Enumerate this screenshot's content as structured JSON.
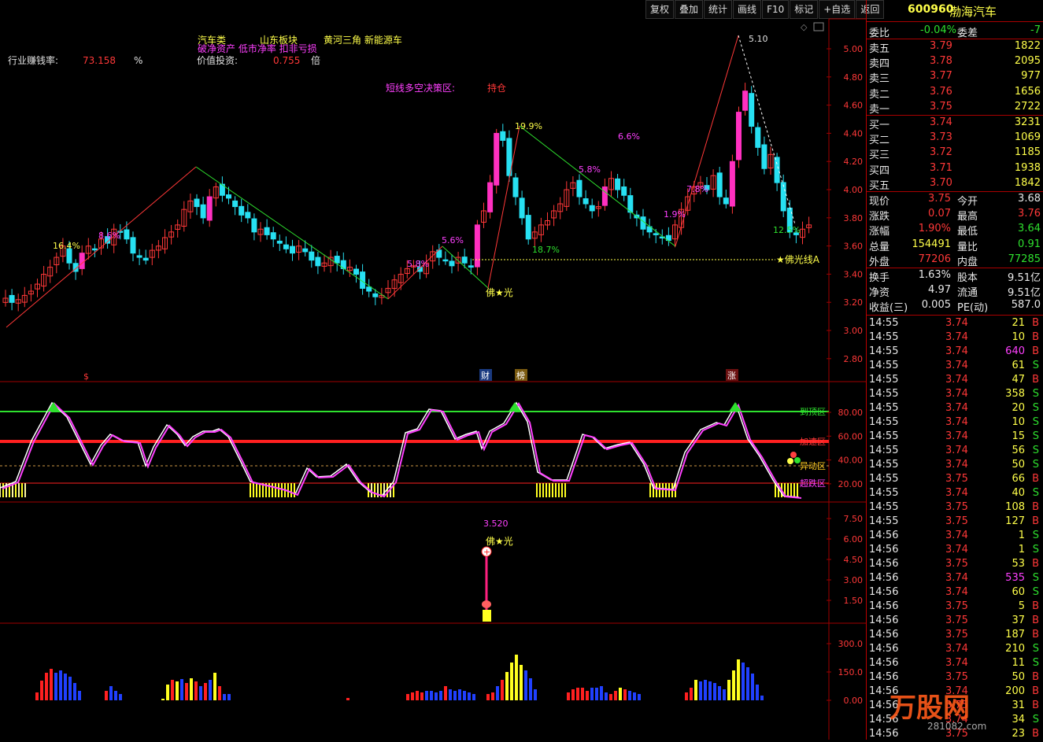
{
  "toolbar": [
    "复权",
    "叠加",
    "统计",
    "画线",
    "F10",
    "标记",
    "+自选",
    "返回"
  ],
  "stock": {
    "code": "600960",
    "name": "渤海汽车"
  },
  "info": {
    "industry_label": "行业赚钱率:",
    "industry_value": "73.158",
    "industry_unit": "%",
    "value_label": "价值投资:",
    "value_value": "0.755",
    "value_unit": "倍",
    "tag1": "汽车类",
    "tag2": "山东板块",
    "tag3": "黄河三角 新能源车",
    "tag4": "破净资产 低市净率 扣非亏损",
    "decision_label": "短线多空决策区:",
    "decision_value": "持仓"
  },
  "main_chart": {
    "y_ticks": [
      "5.00",
      "4.80",
      "4.60",
      "4.40",
      "4.20",
      "4.00",
      "3.80",
      "3.60",
      "3.40",
      "3.20",
      "3.00",
      "2.80"
    ],
    "annotations": [
      "5.10",
      "19.9%",
      "6.6%",
      "5.8%",
      "16.4%",
      "8.6%",
      "5.6%",
      "5.8%",
      "18.7%",
      "1.9%",
      "7.8%",
      "12.5%"
    ],
    "buddha": "佛★光",
    "buddha_line": "★佛光线A",
    "markers": [
      "$",
      "财",
      "榜",
      "涨"
    ]
  },
  "oscillator": {
    "y_ticks": [
      "80.00",
      "60.00",
      "40.00",
      "20.00"
    ],
    "zones": [
      "到顶区",
      "加速区",
      "异动区",
      "超跌区"
    ]
  },
  "signal_panel": {
    "y_ticks": [
      "7.50",
      "6.00",
      "4.50",
      "3.00",
      "1.50"
    ],
    "value": "3.520",
    "label": "佛★光"
  },
  "volume_panel": {
    "y_ticks": [
      "300.0",
      "150.0",
      "0.00"
    ]
  },
  "quote": {
    "weibi_label": "委比",
    "weibi_value": "-0.04%",
    "weicha_label": "委差",
    "weicha_value": "-7",
    "asks": [
      {
        "label": "卖五",
        "price": "3.79",
        "vol": "1822"
      },
      {
        "label": "卖四",
        "price": "3.78",
        "vol": "2095"
      },
      {
        "label": "卖三",
        "price": "3.77",
        "vol": "977"
      },
      {
        "label": "卖二",
        "price": "3.76",
        "vol": "1656"
      },
      {
        "label": "卖一",
        "price": "3.75",
        "vol": "2722"
      }
    ],
    "bids": [
      {
        "label": "买一",
        "price": "3.74",
        "vol": "3231"
      },
      {
        "label": "买二",
        "price": "3.73",
        "vol": "1069"
      },
      {
        "label": "买三",
        "price": "3.72",
        "vol": "1185"
      },
      {
        "label": "买四",
        "price": "3.71",
        "vol": "1938"
      },
      {
        "label": "买五",
        "price": "3.70",
        "vol": "1842"
      }
    ],
    "stats": [
      {
        "l1": "现价",
        "v1": "3.75",
        "c1": "red",
        "l2": "今开",
        "v2": "3.68",
        "c2": "white"
      },
      {
        "l1": "涨跌",
        "v1": "0.07",
        "c1": "red",
        "l2": "最高",
        "v2": "3.76",
        "c2": "red"
      },
      {
        "l1": "涨幅",
        "v1": "1.90%",
        "c1": "red",
        "l2": "最低",
        "v2": "3.64",
        "c2": "green"
      },
      {
        "l1": "总量",
        "v1": "154491",
        "c1": "yellow",
        "l2": "量比",
        "v2": "0.91",
        "c2": "green"
      },
      {
        "l1": "外盘",
        "v1": "77206",
        "c1": "red",
        "l2": "内盘",
        "v2": "77285",
        "c2": "green"
      }
    ],
    "fund": [
      {
        "l1": "换手",
        "v1": "1.63%",
        "l2": "股本",
        "v2": "9.51亿"
      },
      {
        "l1": "净资",
        "v1": "4.97",
        "l2": "流通",
        "v2": "9.51亿"
      },
      {
        "l1": "收益(三)",
        "v1": "0.005",
        "l2": "PE(动)",
        "v2": "587.0"
      }
    ]
  },
  "ticks": [
    {
      "t": "14:55",
      "p": "3.74",
      "v": "21",
      "s": "B"
    },
    {
      "t": "14:55",
      "p": "3.74",
      "v": "10",
      "s": "B"
    },
    {
      "t": "14:55",
      "p": "3.74",
      "v": "640",
      "s": "B"
    },
    {
      "t": "14:55",
      "p": "3.74",
      "v": "61",
      "s": "S"
    },
    {
      "t": "14:55",
      "p": "3.74",
      "v": "47",
      "s": "B"
    },
    {
      "t": "14:55",
      "p": "3.74",
      "v": "358",
      "s": "S"
    },
    {
      "t": "14:55",
      "p": "3.74",
      "v": "20",
      "s": "S"
    },
    {
      "t": "14:55",
      "p": "3.74",
      "v": "10",
      "s": "S"
    },
    {
      "t": "14:55",
      "p": "3.74",
      "v": "15",
      "s": "S"
    },
    {
      "t": "14:55",
      "p": "3.74",
      "v": "56",
      "s": "S"
    },
    {
      "t": "14:55",
      "p": "3.74",
      "v": "50",
      "s": "S"
    },
    {
      "t": "14:55",
      "p": "3.75",
      "v": "66",
      "s": "B"
    },
    {
      "t": "14:55",
      "p": "3.74",
      "v": "40",
      "s": "S"
    },
    {
      "t": "14:55",
      "p": "3.75",
      "v": "108",
      "s": "B"
    },
    {
      "t": "14:55",
      "p": "3.75",
      "v": "127",
      "s": "B"
    },
    {
      "t": "14:56",
      "p": "3.74",
      "v": "1",
      "s": "S"
    },
    {
      "t": "14:56",
      "p": "3.74",
      "v": "1",
      "s": "S"
    },
    {
      "t": "14:56",
      "p": "3.75",
      "v": "53",
      "s": "B"
    },
    {
      "t": "14:56",
      "p": "3.74",
      "v": "535",
      "s": "S"
    },
    {
      "t": "14:56",
      "p": "3.74",
      "v": "60",
      "s": "S"
    },
    {
      "t": "14:56",
      "p": "3.75",
      "v": "5",
      "s": "B"
    },
    {
      "t": "14:56",
      "p": "3.75",
      "v": "37",
      "s": "B"
    },
    {
      "t": "14:56",
      "p": "3.75",
      "v": "187",
      "s": "B"
    },
    {
      "t": "14:56",
      "p": "3.74",
      "v": "210",
      "s": "S"
    },
    {
      "t": "14:56",
      "p": "3.74",
      "v": "11",
      "s": "S"
    },
    {
      "t": "14:56",
      "p": "3.75",
      "v": "50",
      "s": "B"
    },
    {
      "t": "14:56",
      "p": "3.74",
      "v": "200",
      "s": "B"
    },
    {
      "t": "14:56",
      "p": "3.75",
      "v": "31",
      "s": "B"
    },
    {
      "t": "14:56",
      "p": "3.74",
      "v": "34",
      "s": "S"
    },
    {
      "t": "14:56",
      "p": "3.75",
      "v": "23",
      "s": "B"
    }
  ],
  "watermark": {
    "text": "万股网",
    "url": "281082.com"
  },
  "colors": {
    "up": "#ff3838",
    "down": "#27e0f2",
    "magenta": "#ff40ff",
    "border": "#a00000"
  }
}
